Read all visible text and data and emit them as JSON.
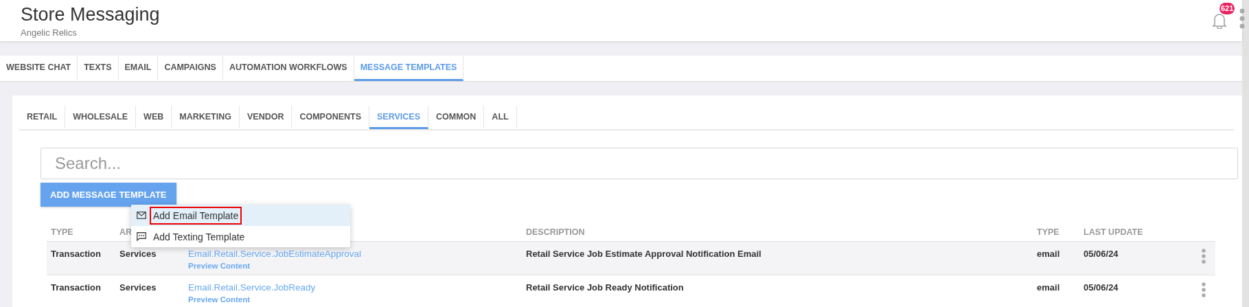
{
  "header": {
    "title": "Store Messaging",
    "subtitle": "Angelic Relics",
    "notification_count": "621"
  },
  "main_tabs": [
    {
      "label": "WEBSITE CHAT",
      "selected": false
    },
    {
      "label": "TEXTS",
      "selected": false
    },
    {
      "label": "EMAIL",
      "selected": false
    },
    {
      "label": "CAMPAIGNS",
      "selected": false
    },
    {
      "label": "AUTOMATION WORKFLOWS",
      "selected": false
    },
    {
      "label": "MESSAGE TEMPLATES",
      "selected": true
    }
  ],
  "category_tabs": [
    {
      "label": "RETAIL",
      "selected": false
    },
    {
      "label": "WHOLESALE",
      "selected": false
    },
    {
      "label": "WEB",
      "selected": false
    },
    {
      "label": "MARKETING",
      "selected": false
    },
    {
      "label": "VENDOR",
      "selected": false
    },
    {
      "label": "COMPONENTS",
      "selected": false
    },
    {
      "label": "SERVICES",
      "selected": true
    },
    {
      "label": "COMMON",
      "selected": false
    },
    {
      "label": "ALL",
      "selected": false
    }
  ],
  "search": {
    "placeholder": "Search..."
  },
  "add_button": "ADD MESSAGE TEMPLATE",
  "add_menu": [
    {
      "kind": "email",
      "label": "Add Email Template",
      "selected": true
    },
    {
      "kind": "text",
      "label": "Add Texting Template",
      "selected": false
    }
  ],
  "table": {
    "columns": [
      "TYPE",
      "AR",
      "",
      "DESCRIPTION",
      "TYPE",
      "LAST UPDATE"
    ],
    "rows": [
      {
        "type": "Transaction",
        "area": "Services",
        "name": "Email.Retail.Service.JobEstimateApproval",
        "preview": "Preview Content",
        "description": "Retail Service Job Estimate Approval Notification Email",
        "template_type": "email",
        "last_update": "05/06/24"
      },
      {
        "type": "Transaction",
        "area": "Services",
        "name": "Email.Retail.Service.JobReady",
        "preview": "Preview Content",
        "description": "Retail Service Job Ready Notification",
        "template_type": "email",
        "last_update": "05/06/24"
      }
    ]
  }
}
